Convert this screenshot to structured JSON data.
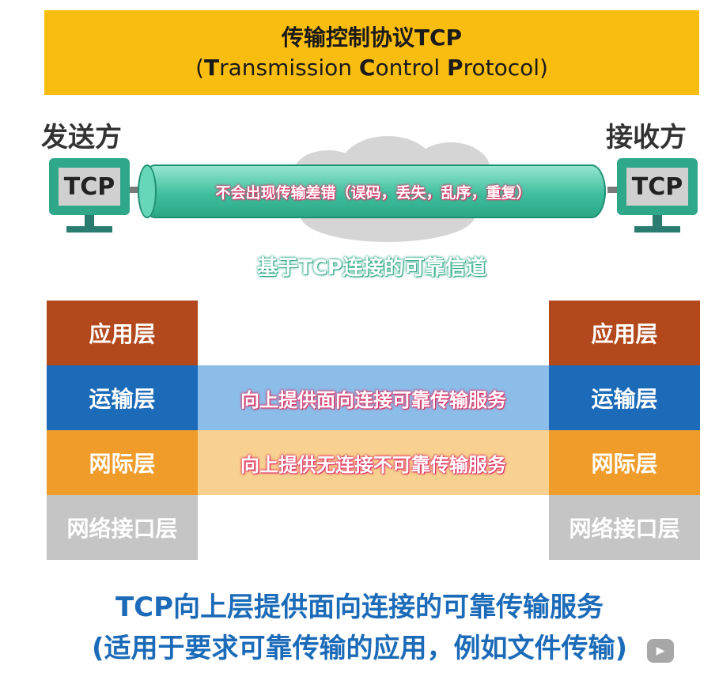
{
  "header": {
    "title": "传输控制协议TCP",
    "subtitle_parts": [
      {
        "text": "(",
        "bold": false
      },
      {
        "text": "T",
        "bold": true
      },
      {
        "text": "ransmission ",
        "bold": false
      },
      {
        "text": "C",
        "bold": true
      },
      {
        "text": "ontrol ",
        "bold": false
      },
      {
        "text": "P",
        "bold": true
      },
      {
        "text": "rotocol)",
        "bold": false
      }
    ]
  },
  "sender": {
    "label": "发送方",
    "computer_text": "TCP"
  },
  "receiver": {
    "label": "接收方",
    "computer_text": "TCP"
  },
  "pipe": {
    "text": "不会出现传输差错（误码，丢失，乱序，重复）"
  },
  "channel_label": "基于TCP连接的可靠信道",
  "left_stack": {
    "application": "应用层",
    "transport": "运输层",
    "internet": "网际层",
    "network_interface": "网络接口层"
  },
  "right_stack": {
    "application": "应用层",
    "transport": "运输层",
    "internet": "网际层",
    "network_interface": "网络接口层"
  },
  "bands": {
    "transport": "向上提供面向连接可靠传输服务",
    "internet": "向上提供无连接不可靠传输服务"
  },
  "summary": {
    "line1": "TCP向上层提供面向连接的可靠传输服务",
    "line2": "(适用于要求可靠传输的应用，例如文件传输)"
  },
  "colors": {
    "header_bg": "#f9bd0f",
    "teal": "#2fa88a",
    "application": "#b3481c",
    "transport": "#1c6bb8",
    "internet": "#f09c2a",
    "network_interface": "#c5c5c5",
    "highlight_text_outline": "#e03466"
  },
  "icons": {
    "player_badge": "play-icon"
  }
}
